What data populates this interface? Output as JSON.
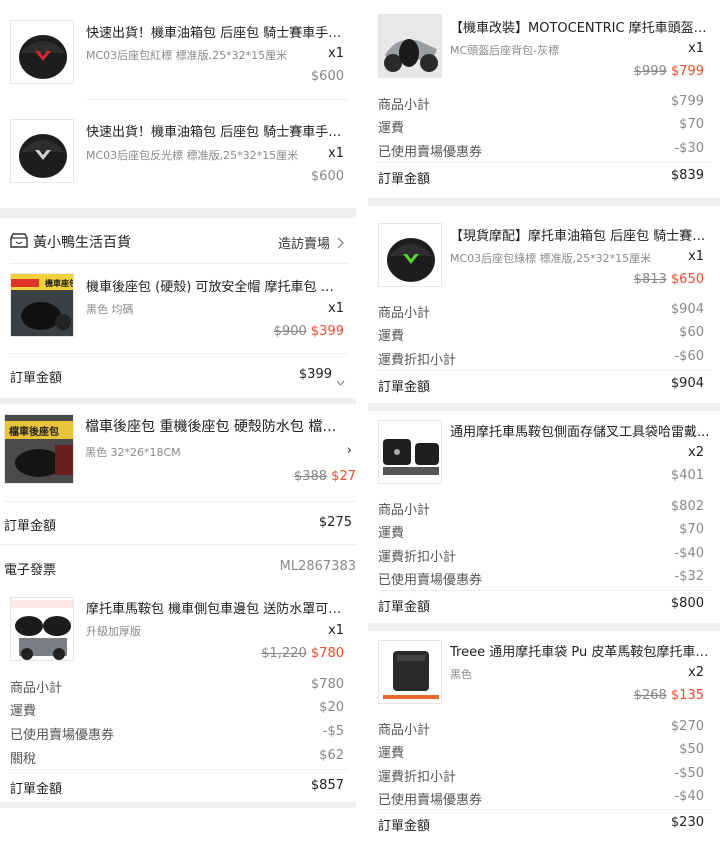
{
  "left": {
    "item1": {
      "title": "快速出貨！機車油箱包 后座包 騎士賽車手提...",
      "variant": "MC03后座包紅標 標准版,25*32*15厘米",
      "qty": "x1",
      "price": "$600"
    },
    "item2": {
      "title": "快速出貨！機車油箱包 后座包 騎士賽車手提...",
      "variant": "MC03后座包反光標 標准版,25*32*15厘米",
      "qty": "x1",
      "price": "$600"
    },
    "shop": {
      "name": "黃小鴨生活百貨",
      "visit": "造訪賣場"
    },
    "item3": {
      "title": "機車後座包 (硬殼) 可放安全帽 摩托車包 安...",
      "variant": "黑色 均碼",
      "qty": "x1",
      "old_price": "$900",
      "price": "$399",
      "thumb_text": "機車座包"
    },
    "total3": {
      "label": "訂單金額",
      "value": "$399"
    },
    "item4": {
      "title": "檔車後座包 重機後座包 硬殼防水包 檔車後...",
      "variant": "黑色 32*26*18CM",
      "old_price": "$388",
      "price": "$27",
      "thumb_text": "檔車後座包"
    },
    "total4": {
      "label": "訂單金額",
      "value": "$275"
    },
    "invoice": {
      "label": "電子發票",
      "value": "ML2867383"
    },
    "item5": {
      "title": "摩托車馬鞍包 機車側包車邊包 送防水罩可放...",
      "variant": "升級加厚版",
      "qty": "x1",
      "old_price": "$1,220",
      "price": "$780"
    },
    "summary5": [
      {
        "label": "商品小計",
        "value": "$780"
      },
      {
        "label": "運費",
        "value": "$20"
      },
      {
        "label": "已使用賣場優惠券",
        "value": "-$5"
      },
      {
        "label": "關稅",
        "value": "$62"
      }
    ],
    "total5": {
      "label": "訂單金額",
      "value": "$857"
    }
  },
  "right": {
    "itemA": {
      "title": "【機車改裝】MOTOCENTRIC 摩托車頭盔包...",
      "variant": "MC頭盔后座背包-灰標",
      "qty": "x1",
      "old_price": "$999",
      "price": "$799"
    },
    "summaryA": [
      {
        "label": "商品小計",
        "value": "$799"
      },
      {
        "label": "運費",
        "value": "$70"
      },
      {
        "label": "已使用賣場優惠券",
        "value": "-$30"
      }
    ],
    "totalA": {
      "label": "訂單金額",
      "value": "$839"
    },
    "itemB": {
      "title": "【現貨摩配】摩托車油箱包 后座包 騎士賽車...",
      "variant": "MC03后座包綠標 標准版,25*32*15厘米",
      "qty": "x1",
      "old_price": "$813",
      "price": "$650"
    },
    "summaryB": [
      {
        "label": "商品小計",
        "value": "$904"
      },
      {
        "label": "運費",
        "value": "$60"
      },
      {
        "label": "運費折扣小計",
        "value": "-$60"
      }
    ],
    "totalB": {
      "label": "訂單金額",
      "value": "$904"
    },
    "itemC": {
      "title": "通用摩托車馬鞍包側面存儲叉工具袋哈雷戴...",
      "qty": "x2",
      "price": "$401"
    },
    "summaryC": [
      {
        "label": "商品小計",
        "value": "$802"
      },
      {
        "label": "運費",
        "value": "$70"
      },
      {
        "label": "運費折扣小計",
        "value": "-$40"
      },
      {
        "label": "已使用賣場優惠券",
        "value": "-$32"
      }
    ],
    "totalC": {
      "label": "訂單金額",
      "value": "$800"
    },
    "itemD": {
      "title": "Treee 通用摩托車袋 Pu 皮革馬鞍包摩托車卷...",
      "variant": "黑色",
      "qty": "x2",
      "old_price": "$268",
      "price": "$135"
    },
    "summaryD": [
      {
        "label": "商品小計",
        "value": "$270"
      },
      {
        "label": "運費",
        "value": "$50"
      },
      {
        "label": "運費折扣小計",
        "value": "-$50"
      },
      {
        "label": "已使用賣場優惠券",
        "value": "-$40"
      }
    ],
    "totalD": {
      "label": "訂單金額",
      "value": "$230"
    }
  },
  "icons": {
    "store": "store-icon",
    "chevron_right": "chevron-right-icon",
    "chevron_down": "chevron-down-icon"
  },
  "colors": {
    "accent": "#ee4d2d",
    "muted": "#888888",
    "divider": "#eeeeee",
    "band": "#f0f0f0"
  }
}
